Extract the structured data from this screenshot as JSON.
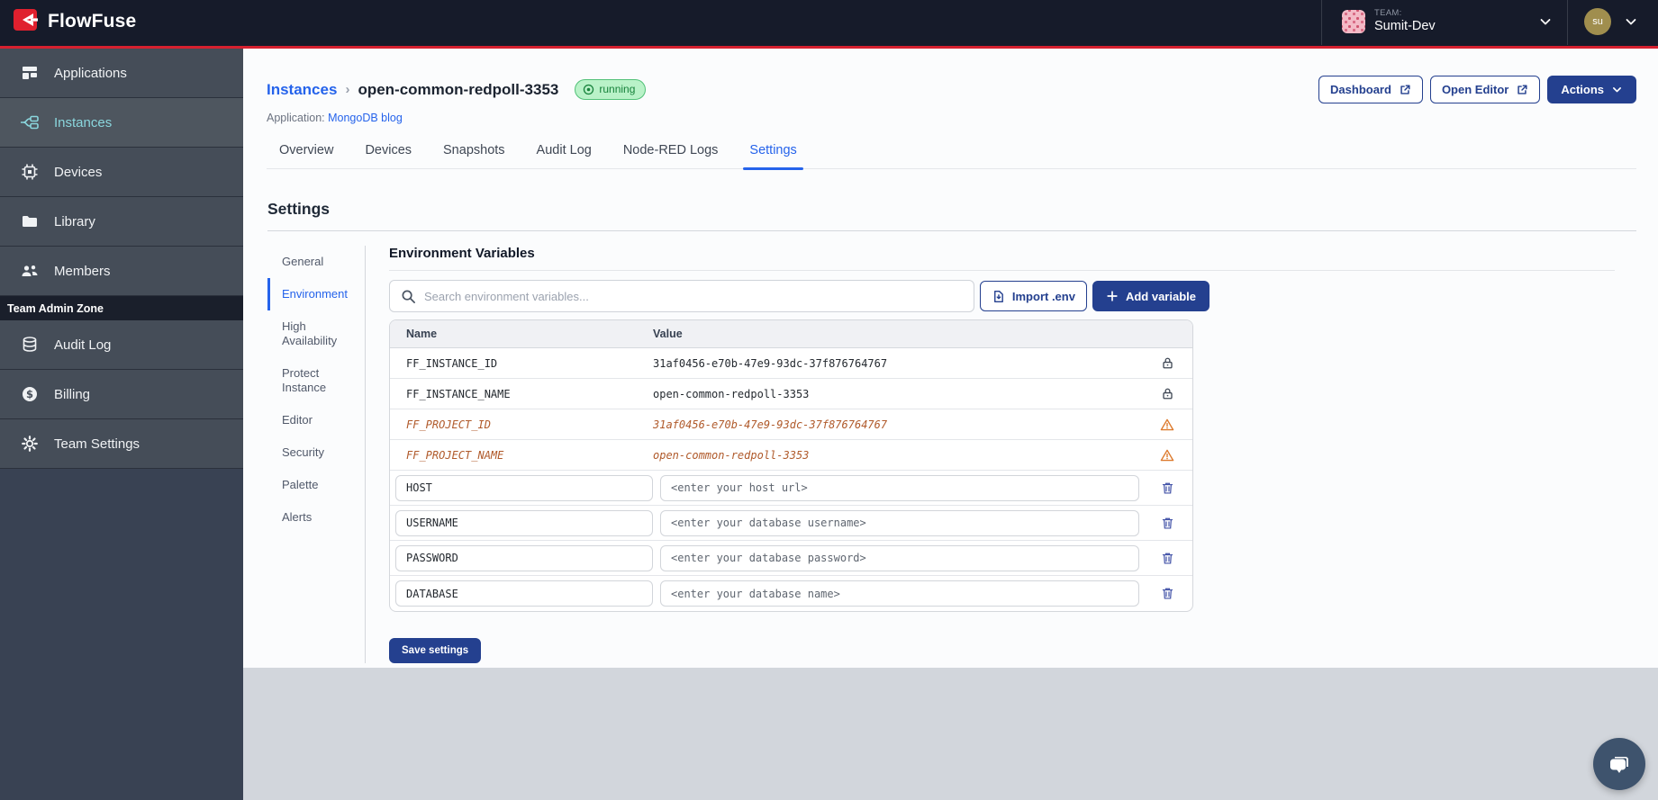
{
  "topbar": {
    "brand": "FlowFuse",
    "team_label": "TEAM:",
    "team_name": "Sumit-Dev",
    "user_initials": "su"
  },
  "sidebar": {
    "items": [
      {
        "label": "Applications"
      },
      {
        "label": "Instances"
      },
      {
        "label": "Devices"
      },
      {
        "label": "Library"
      },
      {
        "label": "Members"
      }
    ],
    "admin_zone_label": "Team Admin Zone",
    "admin_items": [
      {
        "label": "Audit Log"
      },
      {
        "label": "Billing"
      },
      {
        "label": "Team Settings"
      }
    ],
    "active_item": "Instances"
  },
  "header": {
    "breadcrumb_parent": "Instances",
    "breadcrumb_separator": "›",
    "breadcrumb_current": "open-common-redpoll-3353",
    "status_badge": "running",
    "application_label": "Application:",
    "application_name": "MongoDB blog",
    "dashboard_button": "Dashboard",
    "open_editor_button": "Open Editor",
    "actions_button": "Actions"
  },
  "tabs": {
    "items": [
      {
        "label": "Overview"
      },
      {
        "label": "Devices"
      },
      {
        "label": "Snapshots"
      },
      {
        "label": "Audit Log"
      },
      {
        "label": "Node-RED Logs"
      },
      {
        "label": "Settings"
      }
    ],
    "active": "Settings"
  },
  "settings": {
    "title": "Settings",
    "nav": {
      "items": [
        {
          "label": "General"
        },
        {
          "label": "Environment"
        },
        {
          "label": "High Availability"
        },
        {
          "label": "Protect Instance"
        },
        {
          "label": "Editor"
        },
        {
          "label": "Security"
        },
        {
          "label": "Palette"
        },
        {
          "label": "Alerts"
        }
      ],
      "active": "Environment"
    },
    "environment": {
      "title": "Environment Variables",
      "search_placeholder": "Search environment variables...",
      "import_button": "Import .env",
      "add_button": "Add variable",
      "columns": {
        "name": "Name",
        "value": "Value"
      },
      "readonly_rows": [
        {
          "name": "FF_INSTANCE_ID",
          "value": "31af0456-e70b-47e9-93dc-37f876764767",
          "state": "locked"
        },
        {
          "name": "FF_INSTANCE_NAME",
          "value": "open-common-redpoll-3353",
          "state": "locked"
        },
        {
          "name": "FF_PROJECT_ID",
          "value": "31af0456-e70b-47e9-93dc-37f876764767",
          "state": "deprecated"
        },
        {
          "name": "FF_PROJECT_NAME",
          "value": "open-common-redpoll-3353",
          "state": "deprecated"
        }
      ],
      "editable_rows": [
        {
          "name": "HOST",
          "value_placeholder": "<enter your host url>"
        },
        {
          "name": "USERNAME",
          "value_placeholder": "<enter your database username>"
        },
        {
          "name": "PASSWORD",
          "value_placeholder": "<enter your database password>"
        },
        {
          "name": "DATABASE",
          "value_placeholder": "<enter your database name>"
        }
      ],
      "save_button": "Save settings"
    }
  },
  "colors": {
    "accent_red": "#d6202f",
    "navy_button": "#24408f",
    "link_blue": "#2563eb",
    "running_green": "#17823b",
    "deprecated_orange": "#b05a2b",
    "sidebar_active_teal": "#8ad6dd",
    "topbar_bg": "#161b2a",
    "sidebar_bg": "#394253"
  }
}
